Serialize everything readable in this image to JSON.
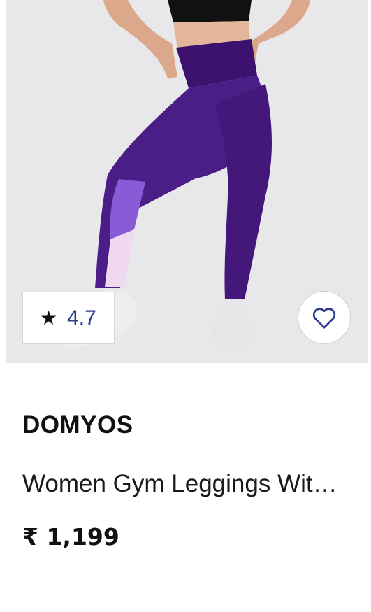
{
  "product": {
    "image_name": "leggings-photo",
    "rating": "4.7",
    "rating_icon": "star-icon",
    "wishlist_icon": "heart-outline-icon",
    "brand": "DOMYOS",
    "name": "Women Gym Leggings With Pockets",
    "price": "₹ 1,199"
  },
  "colors": {
    "image_background": "#e8e8ea",
    "rating_text": "#2d3a8c",
    "heart_stroke": "#2d3a8c",
    "legging_main": "#4b1d86",
    "legging_accent": "#8a5bd6",
    "legging_light": "#f0d8f0"
  }
}
